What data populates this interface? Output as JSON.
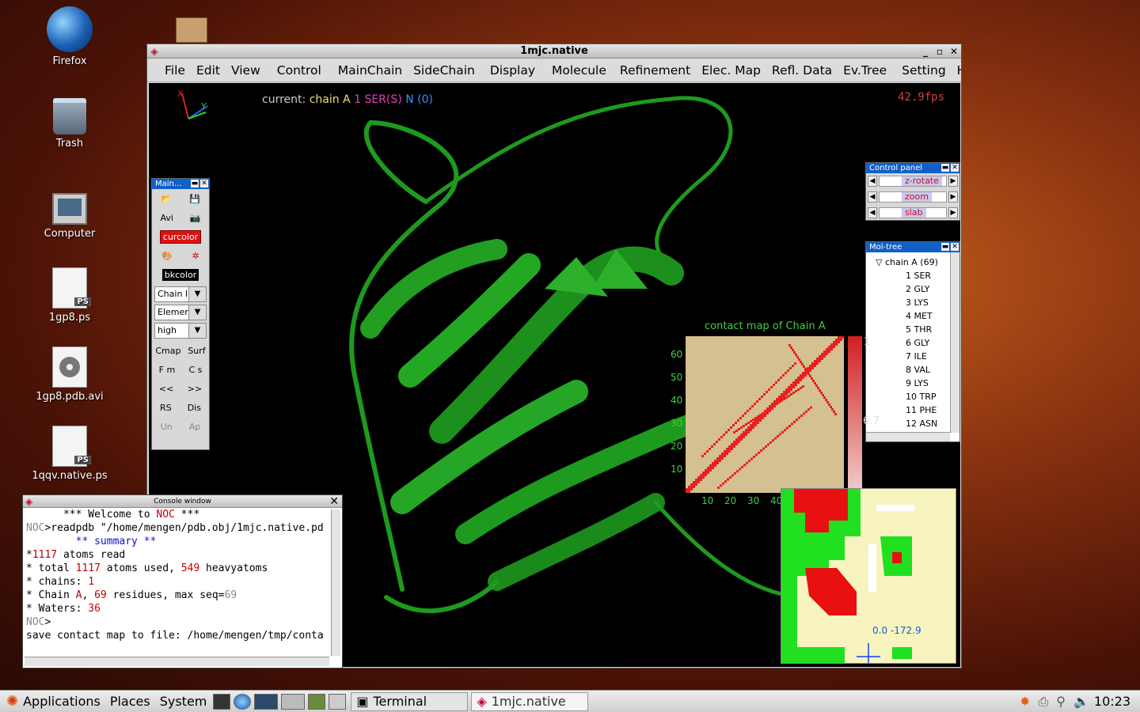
{
  "desktop": {
    "icons": [
      {
        "label": "Firefox",
        "icon": "firefox-icon"
      },
      {
        "label": "Trash",
        "icon": "trash-icon"
      },
      {
        "label": "Computer",
        "icon": "computer-icon"
      },
      {
        "label": "1gp8.ps",
        "icon": "postscript-file-icon"
      },
      {
        "label": "1gp8.pdb.avi",
        "icon": "video-file-icon"
      },
      {
        "label": "1qqv.native.ps",
        "icon": "postscript-file-icon"
      }
    ],
    "ps_badge": "PS"
  },
  "window": {
    "title": "1mjc.native",
    "controls": {
      "min": "_",
      "max": "▫",
      "close": "✕"
    },
    "menu": [
      "File",
      "Edit",
      "View",
      "Control",
      "MainChain",
      "SideChain",
      "Display",
      "Molecule",
      "Refinement",
      "Elec. Map",
      "Refl. Data",
      "Ev.Tree",
      "Setting",
      "He"
    ]
  },
  "viewer": {
    "current_label": "current:",
    "current_chain": "chain A",
    "current_residue": "1 SER(S)",
    "current_atom": "N",
    "current_index": "(0)",
    "fps": "42.9fps",
    "axes": {
      "x": "X",
      "y": "Y"
    },
    "colors": {
      "ribbon": "#1e9a1e",
      "hud_green": "#3fcf3f"
    }
  },
  "main_panel": {
    "title": "Main...",
    "avi": "Avi",
    "curcolor": "curcolor",
    "bkcolor": "bkcolor",
    "combos": [
      "Chain I",
      "Elemer",
      "high"
    ],
    "buttons": [
      [
        "Cmap",
        "Surf"
      ],
      [
        "F m",
        "C s"
      ],
      [
        "<<",
        ">>"
      ],
      [
        "RS",
        "Dis"
      ],
      [
        "Un",
        "Ap"
      ]
    ]
  },
  "control_panel": {
    "title": "Control panel",
    "sliders": [
      "z-rotate",
      "zoom",
      "slab"
    ]
  },
  "mol_tree": {
    "title": "Mol-tree",
    "root": "chain A (69)",
    "residues": [
      "1 SER",
      "2 GLY",
      "3 LYS",
      "4 MET",
      "5 THR",
      "6 GLY",
      "7 ILE",
      "8 VAL",
      "9 LYS",
      "10 TRP",
      "11 PHE",
      "12 ASN"
    ]
  },
  "contact_map": {
    "title": "contact map of Chain A",
    "y_ticks": [
      "60",
      "50",
      "40",
      "30",
      "20",
      "10"
    ],
    "x_ticks": [
      "10",
      "20",
      "30",
      "40"
    ],
    "bar_top": "1",
    "bar_mid": "6.7"
  },
  "ramachandran": {
    "readout": "0.0 -172.9"
  },
  "console": {
    "title": "Console window",
    "lines": [
      {
        "t": "      *** Welcome to ",
        "r": "NOC",
        "t2": " ***"
      },
      {
        "g": "NOC",
        "t": ">readpdb \"/home/mengen/pdb.obj/1mjc.native.pd"
      },
      {
        "t": ""
      },
      {
        "b": "        ** summary **"
      },
      {
        "t": "*",
        "r": "1117",
        "t2": " atoms read"
      },
      {
        "t": "* total ",
        "r": "1117",
        "t2": " atoms used, ",
        "r2": "549",
        "t3": " heavyatoms"
      },
      {
        "t": "* chains: ",
        "r": "1"
      },
      {
        "t": "* Chain ",
        "r": "A",
        "t2": ", ",
        "r2": "69",
        "t3": " residues, max seq=",
        "g2": "69"
      },
      {
        "t": "* Waters: ",
        "r": "36"
      },
      {
        "g": "NOC",
        "t": ">"
      },
      {
        "t": "save contact map to file: /home/mengen/tmp/conta"
      }
    ]
  },
  "taskbar": {
    "applications": "Applications",
    "places": "Places",
    "system": "System",
    "tasks": [
      "Terminal",
      "1mjc.native"
    ],
    "clock": "10:23"
  }
}
